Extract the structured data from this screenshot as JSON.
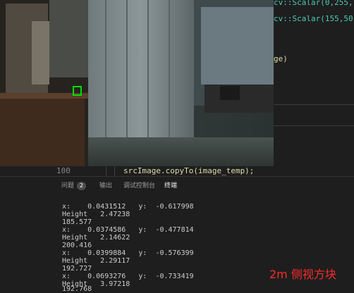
{
  "editor": {
    "code_top1": "cv::Scalar(0,255,",
    "code_top2": "cv::Scalar(155,50,",
    "code_top3": "ge)",
    "line_number": "100",
    "line_code": "srcImage.copyTo(image_temp);"
  },
  "panel": {
    "tab_problems": "问题",
    "problems_count": "2",
    "tab_output": "输出",
    "tab_debug_console": "调试控制台",
    "tab_terminal": "终端"
  },
  "terminal": {
    "lines": [
      "x:    0.0431512   y:  -0.617998",
      "Height   2.47238",
      "185.577",
      "x:    0.0374586   y:  -0.477814",
      "Height   2.14622",
      "200.416",
      "x:    0.0399884   y:  -0.576399",
      "Height   2.29117",
      "192.727",
      "x:    0.0693276   y:  -0.733419",
      "Height   3.97218",
      "192.768"
    ]
  },
  "overlay": {
    "caption": "2m 侧视方块"
  },
  "colors": {
    "editor_bg": "#1e1e1e",
    "marker_green": "#00e000",
    "caption_red": "#ff2a2a"
  }
}
